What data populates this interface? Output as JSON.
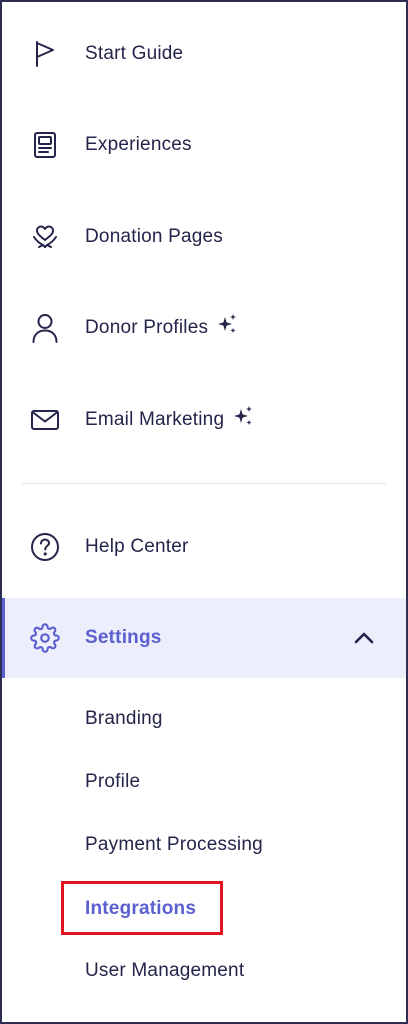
{
  "nav": {
    "items": [
      {
        "label": "Start Guide",
        "icon": "flag-icon"
      },
      {
        "label": "Experiences",
        "icon": "document-icon"
      },
      {
        "label": "Donation Pages",
        "icon": "heart-hands-icon"
      },
      {
        "label": "Donor Profiles",
        "icon": "person-icon",
        "badge": "sparkle-icon"
      },
      {
        "label": "Email Marketing",
        "icon": "envelope-icon",
        "badge": "sparkle-icon"
      }
    ],
    "secondary": [
      {
        "label": "Help Center",
        "icon": "question-circle-icon"
      },
      {
        "label": "Settings",
        "icon": "gear-icon",
        "expanded": true,
        "state": "active"
      }
    ],
    "settings_sub": [
      {
        "label": "Branding"
      },
      {
        "label": "Profile"
      },
      {
        "label": "Payment Processing"
      },
      {
        "label": "Integrations",
        "state": "highlighted"
      },
      {
        "label": "User Management"
      }
    ]
  },
  "colors": {
    "text": "#24254a",
    "accent": "#5b5fcf",
    "active_bg": "#eceefb",
    "highlight_border": "#e0141e",
    "frame_border": "#2b2d52"
  }
}
